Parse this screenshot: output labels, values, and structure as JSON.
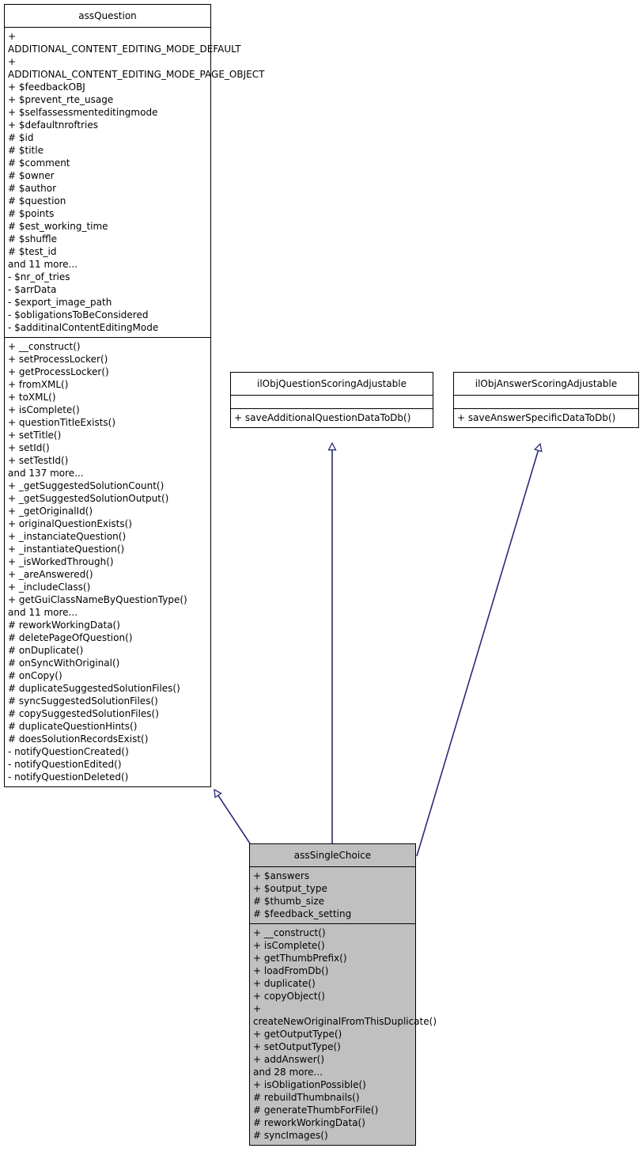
{
  "diagram": {
    "type": "uml-class-diagram",
    "colors": {
      "background": "#ffffff",
      "box_border": "#000000",
      "box_fill": "#ffffff",
      "highlight_fill": "#c0c0c0",
      "edge": "#2a2a7a",
      "text": "#000000"
    }
  },
  "classes": {
    "assQuestion": {
      "name": "assQuestion",
      "filled": false,
      "attributes": [
        "+ ADDITIONAL_CONTENT_EDITING_MODE_DEFAULT",
        "+ ADDITIONAL_CONTENT_EDITING_MODE_PAGE_OBJECT",
        "+ $feedbackOBJ",
        "+ $prevent_rte_usage",
        "+ $selfassessmenteditingmode",
        "+ $defaultnroftries",
        "# $id",
        "# $title",
        "# $comment",
        "# $owner",
        "# $author",
        "# $question",
        "# $points",
        "# $est_working_time",
        "# $shuffle",
        "# $test_id",
        "and 11 more...",
        "- $nr_of_tries",
        "- $arrData",
        "- $export_image_path",
        "- $obligationsToBeConsidered",
        "- $additinalContentEditingMode"
      ],
      "methods": [
        "+ __construct()",
        "+ setProcessLocker()",
        "+ getProcessLocker()",
        "+ fromXML()",
        "+ toXML()",
        "+ isComplete()",
        "+ questionTitleExists()",
        "+ setTitle()",
        "+ setId()",
        "+ setTestId()",
        "and 137 more...",
        "+ _getSuggestedSolutionCount()",
        "+ _getSuggestedSolutionOutput()",
        "+ _getOriginalId()",
        "+ originalQuestionExists()",
        "+ _instanciateQuestion()",
        "+ _instantiateQuestion()",
        "+ _isWorkedThrough()",
        "+ _areAnswered()",
        "+ _includeClass()",
        "+ getGuiClassNameByQuestionType()",
        "and 11 more...",
        "# reworkWorkingData()",
        "# deletePageOfQuestion()",
        "# onDuplicate()",
        "# onSyncWithOriginal()",
        "# onCopy()",
        "# duplicateSuggestedSolutionFiles()",
        "# syncSuggestedSolutionFiles()",
        "# copySuggestedSolutionFiles()",
        "# duplicateQuestionHints()",
        "# doesSolutionRecordsExist()",
        "- notifyQuestionCreated()",
        "- notifyQuestionEdited()",
        "- notifyQuestionDeleted()"
      ]
    },
    "ilObjQuestionScoringAdjustable": {
      "name": "ilObjQuestionScoringAdjustable",
      "filled": false,
      "attributes": [],
      "methods": [
        "+ saveAdditionalQuestionDataToDb()"
      ]
    },
    "ilObjAnswerScoringAdjustable": {
      "name": "ilObjAnswerScoringAdjustable",
      "filled": false,
      "attributes": [],
      "methods": [
        "+ saveAnswerSpecificDataToDb()"
      ]
    },
    "assSingleChoice": {
      "name": "assSingleChoice",
      "filled": true,
      "attributes": [
        "+ $answers",
        "+ $output_type",
        "# $thumb_size",
        "# $feedback_setting"
      ],
      "methods": [
        "+ __construct()",
        "+ isComplete()",
        "+ getThumbPrefix()",
        "+ loadFromDb()",
        "+ duplicate()",
        "+ copyObject()",
        "+ createNewOriginalFromThisDuplicate()",
        "+ getOutputType()",
        "+ setOutputType()",
        "+ addAnswer()",
        "and 28 more...",
        "+ isObligationPossible()",
        "# rebuildThumbnails()",
        "# generateThumbForFile()",
        "# reworkWorkingData()",
        "# syncImages()"
      ]
    }
  },
  "relations": [
    {
      "name": "assSingleChoice-extends-assQuestion",
      "from": "assSingleChoice",
      "to": "assQuestion",
      "kind": "generalization"
    },
    {
      "name": "assSingleChoice-implements-ilObjQuestionScoringAdjustable",
      "from": "assSingleChoice",
      "to": "ilObjQuestionScoringAdjustable",
      "kind": "generalization"
    },
    {
      "name": "assSingleChoice-implements-ilObjAnswerScoringAdjustable",
      "from": "assSingleChoice",
      "to": "ilObjAnswerScoringAdjustable",
      "kind": "generalization"
    }
  ]
}
